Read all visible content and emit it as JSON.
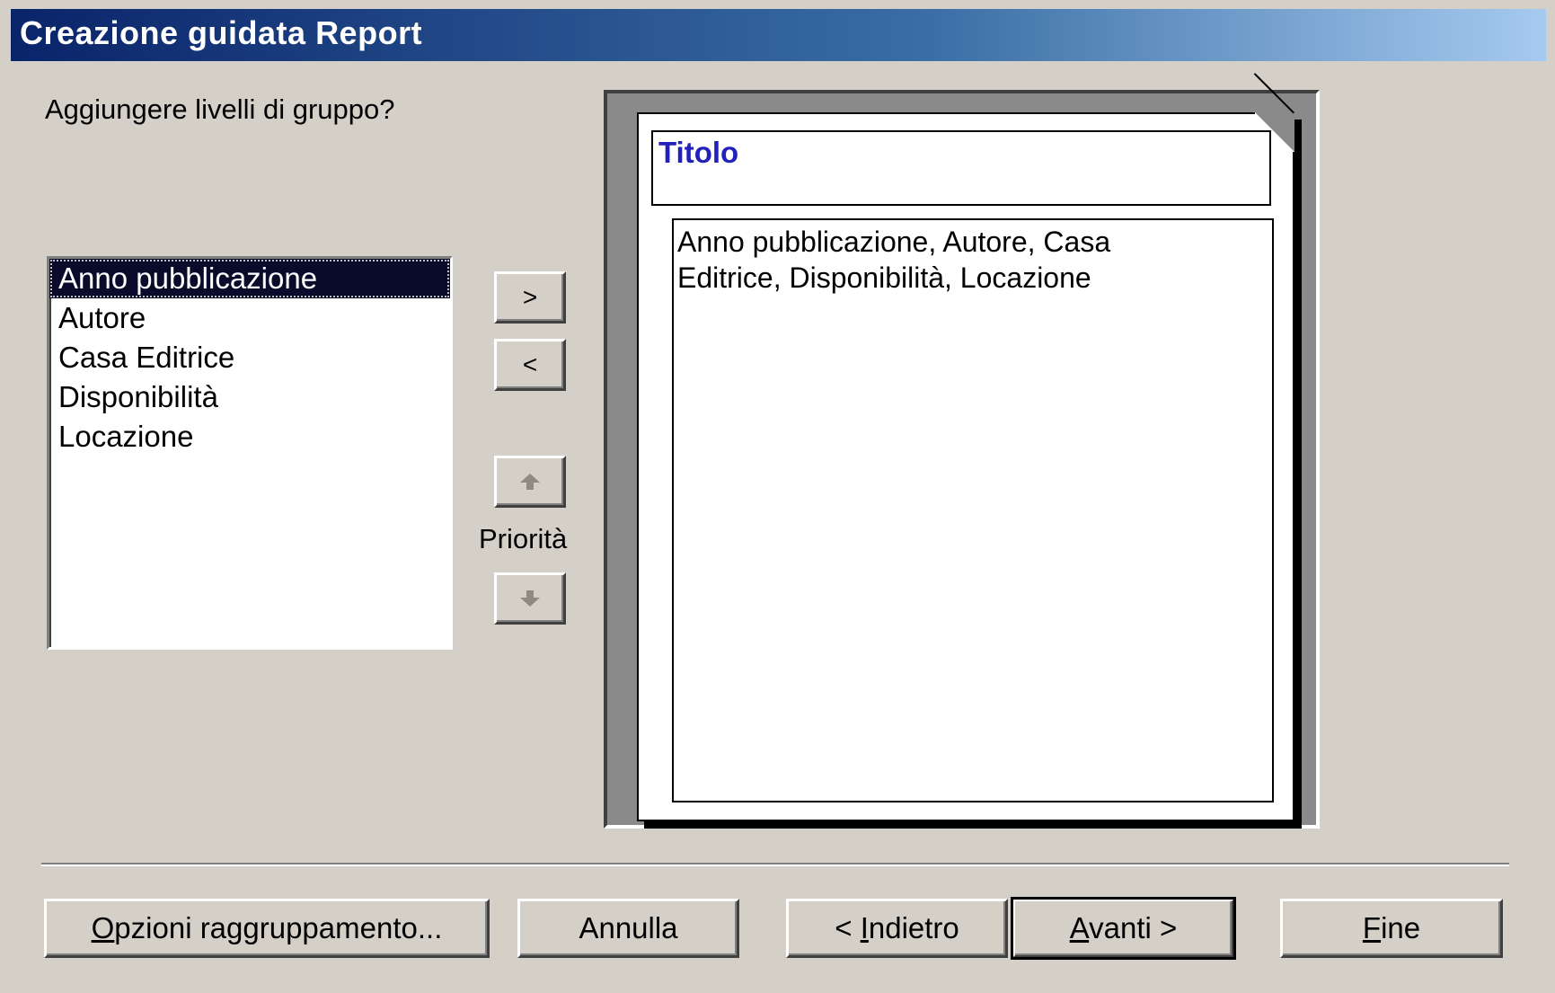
{
  "window": {
    "title": "Creazione guidata Report"
  },
  "question": "Aggiungere livelli di gruppo?",
  "fields": [
    "Anno pubblicazione",
    "Autore",
    "Casa Editrice",
    "Disponibilità",
    "Locazione"
  ],
  "selected_field_index": 0,
  "move_buttons": {
    "add": ">",
    "remove": "<"
  },
  "priority": {
    "label": "Priorità"
  },
  "preview": {
    "title": "Titolo",
    "detail": "Anno pubblicazione, Autore, Casa Editrice, Disponibilità, Locazione"
  },
  "buttons": {
    "grouping_options": {
      "label": "Opzioni raggruppamento...",
      "access_key": "O"
    },
    "cancel": {
      "label": "Annulla"
    },
    "back": {
      "label": "< Indietro",
      "access_key": "I"
    },
    "next": {
      "label": "Avanti >",
      "access_key": "A"
    },
    "finish": {
      "label": "Fine",
      "access_key": "F"
    }
  }
}
